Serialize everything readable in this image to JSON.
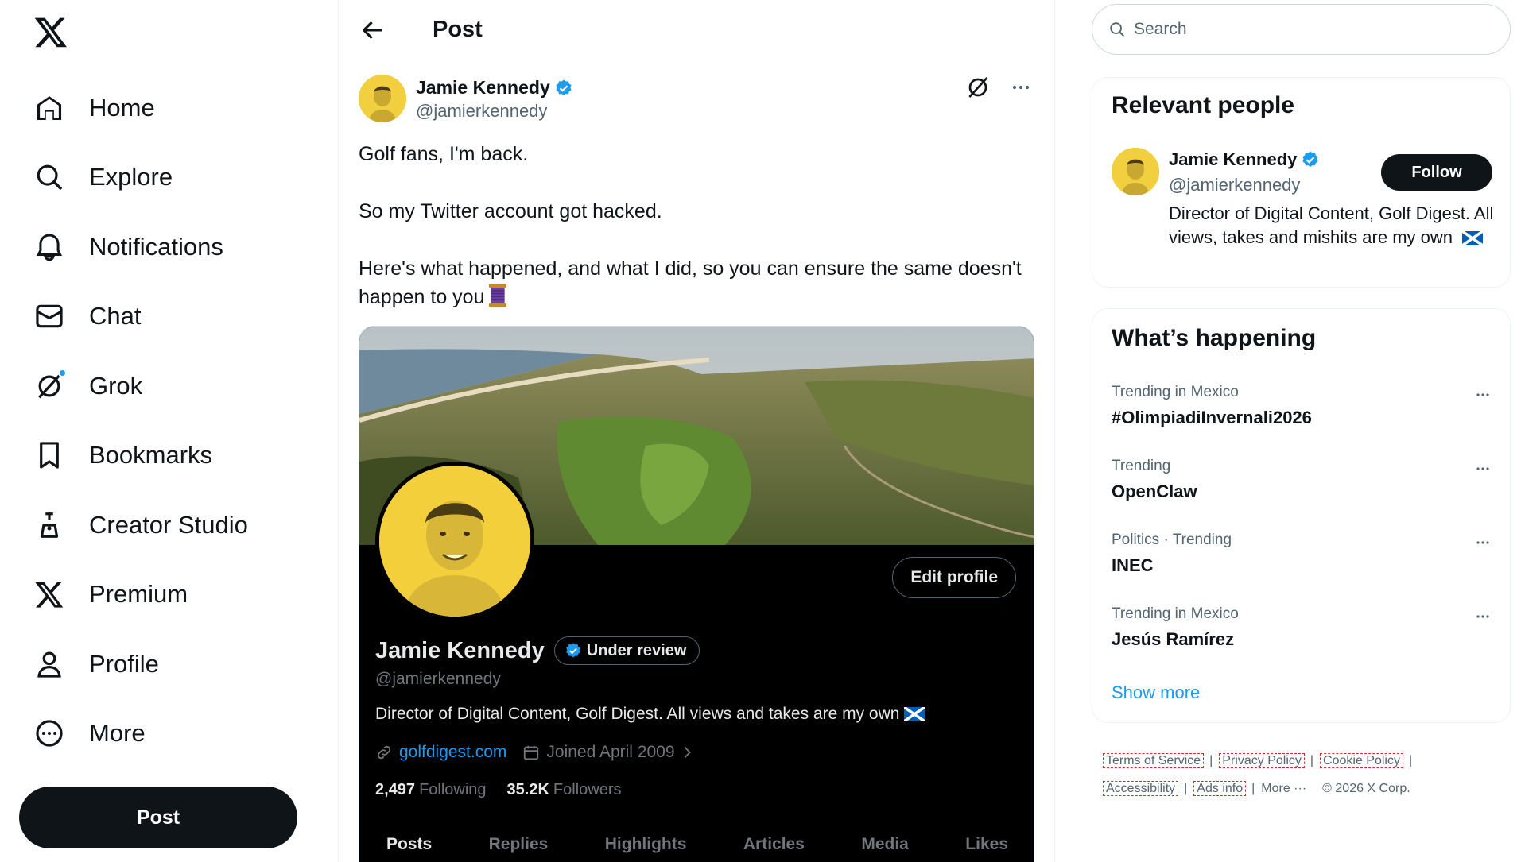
{
  "app": {
    "logo": "x-logo"
  },
  "nav": {
    "items": [
      {
        "label": "Home",
        "icon": "home-icon"
      },
      {
        "label": "Explore",
        "icon": "search-icon"
      },
      {
        "label": "Notifications",
        "icon": "bell-icon"
      },
      {
        "label": "Chat",
        "icon": "envelope-icon"
      },
      {
        "label": "Grok",
        "icon": "grok-icon"
      },
      {
        "label": "Bookmarks",
        "icon": "bookmark-icon"
      },
      {
        "label": "Creator Studio",
        "icon": "creator-studio-icon"
      },
      {
        "label": "Premium",
        "icon": "x-premium-icon"
      },
      {
        "label": "Profile",
        "icon": "person-icon"
      },
      {
        "label": "More",
        "icon": "more-circle-icon"
      }
    ],
    "post_button": "Post"
  },
  "main": {
    "title": "Post",
    "post": {
      "author_name": "Jamie Kennedy",
      "author_handle": "@jamierkennedy",
      "text": {
        "line1": "Golf fans, I'm back.",
        "line2": "So my Twitter account got hacked.",
        "line3": "Here's what happened, and what I did, so you can ensure the same doesn't happen to you"
      },
      "media": {
        "edit_profile": "Edit profile",
        "name": "Jamie Kennedy",
        "badge": "Under review",
        "handle": "@jamierkennedy",
        "bio": "Director of Digital Content, Golf Digest. All views and takes are my own",
        "link": "golfdigest.com",
        "joined": "Joined April 2009",
        "following_count": "2,497",
        "following_label": "Following",
        "followers_count": "35.2K",
        "followers_label": "Followers",
        "tabs": [
          "Posts",
          "Replies",
          "Highlights",
          "Articles",
          "Media",
          "Likes"
        ]
      }
    }
  },
  "right": {
    "search_placeholder": "Search",
    "relevant": {
      "title": "Relevant people",
      "name": "Jamie Kennedy",
      "handle": "@jamierkennedy",
      "follow": "Follow",
      "bio": "Director of Digital Content, Golf Digest. All views, takes and mishits are my own"
    },
    "trends": {
      "title": "What’s happening",
      "items": [
        {
          "context": "Trending in Mexico",
          "name": "#OlimpiadiInvernali2026"
        },
        {
          "context": "Trending",
          "name": "OpenClaw"
        },
        {
          "context": "Politics · Trending",
          "name": "INEC"
        },
        {
          "context": "Trending in Mexico",
          "name": "Jesús Ramírez"
        }
      ],
      "show_more": "Show more"
    },
    "footer": {
      "terms": "Terms of Service",
      "privacy": "Privacy Policy",
      "cookie": "Cookie Policy",
      "accessibility": "Accessibility",
      "ads": "Ads info",
      "more": "More ···",
      "copyright": "© 2026 X Corp."
    }
  },
  "colors": {
    "accent": "#1d9bf0",
    "text": "#0f1419",
    "muted": "#536471"
  }
}
